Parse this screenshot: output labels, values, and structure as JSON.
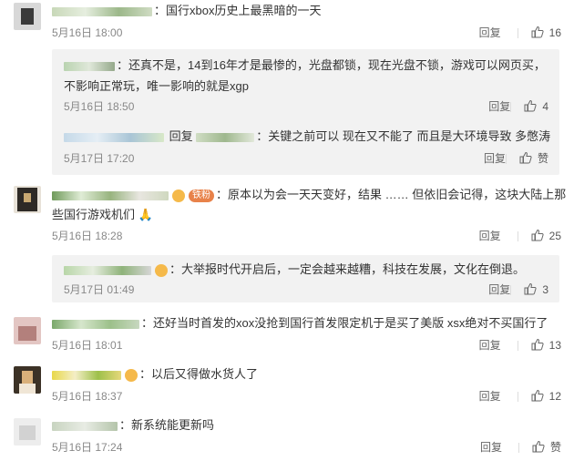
{
  "labels": {
    "reply": "回复",
    "like_text": "赞"
  },
  "comments": [
    {
      "text": "国行xbox历史上最黑暗的一天",
      "date": "5月16日 18:00",
      "likes": "16",
      "replies": [
        {
          "text_line1": "还真不是，14到16年才是最惨的，光盘都锁，现在光盘不锁，游戏可以网页买，",
          "text_line2": "不影响正常玩，唯一影响的就是xgp",
          "date": "5月16日 18:50",
          "likes": "4"
        },
        {
          "prefix": "回复",
          "text": "关键之前可以 现在又不能了 而且是大环境导致 多憋涛",
          "date": "5月17日 17:20",
          "likes": "赞"
        }
      ]
    },
    {
      "text_line1": "原本以为会一天天变好，结果 …… 但依旧会记得，这块大陆上那",
      "text_line2": "些国行游戏机们",
      "badge": "铁粉",
      "date": "5月16日 18:28",
      "likes": "25",
      "replies": [
        {
          "text": "大举报时代开启后，一定会越来越糟，科技在发展，文化在倒退。",
          "date": "5月17日 01:49",
          "likes": "3"
        }
      ]
    },
    {
      "text": "还好当时首发的xox没抢到国行首发限定机于是买了美版 xsx绝对不买国行了",
      "date": "5月16日 18:01",
      "likes": "13"
    },
    {
      "text": "以后又得做水货人了",
      "date": "5月16日 18:37",
      "likes": "12"
    },
    {
      "text": "新系统能更新吗",
      "date": "5月16日 17:24",
      "likes": "赞"
    }
  ],
  "colors": {
    "reply_bg": "#f2f2f2",
    "meta": "#888888",
    "badge": "#e8824a"
  }
}
